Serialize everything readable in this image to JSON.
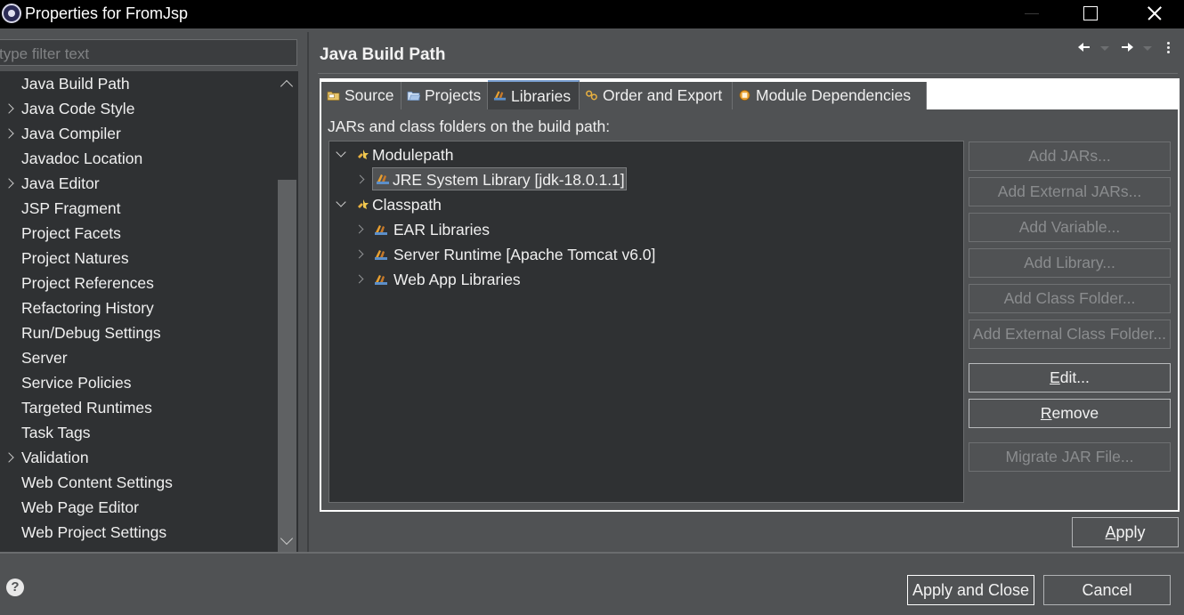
{
  "window": {
    "title": "Properties for FromJsp"
  },
  "filter": {
    "placeholder": "type filter text"
  },
  "nav_tree": {
    "items": [
      {
        "label": "Java Build Path",
        "expandable": false
      },
      {
        "label": "Java Code Style",
        "expandable": true
      },
      {
        "label": "Java Compiler",
        "expandable": true
      },
      {
        "label": "Javadoc Location",
        "expandable": false
      },
      {
        "label": "Java Editor",
        "expandable": true
      },
      {
        "label": "JSP Fragment",
        "expandable": false
      },
      {
        "label": "Project Facets",
        "expandable": false
      },
      {
        "label": "Project Natures",
        "expandable": false
      },
      {
        "label": "Project References",
        "expandable": false
      },
      {
        "label": "Refactoring History",
        "expandable": false
      },
      {
        "label": "Run/Debug Settings",
        "expandable": false
      },
      {
        "label": "Server",
        "expandable": false
      },
      {
        "label": "Service Policies",
        "expandable": false
      },
      {
        "label": "Targeted Runtimes",
        "expandable": false
      },
      {
        "label": "Task Tags",
        "expandable": false
      },
      {
        "label": "Validation",
        "expandable": true
      },
      {
        "label": "Web Content Settings",
        "expandable": false
      },
      {
        "label": "Web Page Editor",
        "expandable": false
      },
      {
        "label": "Web Project Settings",
        "expandable": false
      }
    ]
  },
  "page": {
    "title": "Java Build Path"
  },
  "tabs": [
    {
      "label": "Source",
      "icon": "source-folder-icon",
      "active": false
    },
    {
      "label": "Projects",
      "icon": "projects-folder-icon",
      "active": false
    },
    {
      "label": "Libraries",
      "icon": "libraries-icon",
      "active": true
    },
    {
      "label": "Order and Export",
      "icon": "order-export-icon",
      "active": false
    },
    {
      "label": "Module Dependencies",
      "icon": "module-icon",
      "active": false
    }
  ],
  "libraries": {
    "heading": "JARs and class folders on the build path:",
    "tree": {
      "modulepath": {
        "label": "Modulepath",
        "children": [
          "JRE System Library [jdk-18.0.1.1]"
        ]
      },
      "classpath": {
        "label": "Classpath",
        "children": [
          "EAR Libraries",
          "Server Runtime [Apache Tomcat v6.0]",
          "Web App Libraries"
        ]
      }
    },
    "selected": "JRE System Library [jdk-18.0.1.1]"
  },
  "buttons": {
    "add_jars": "Add JARs...",
    "add_external_jars": "Add External JARs...",
    "add_variable": "Add Variable...",
    "add_library": "Add Library...",
    "add_class_folder": "Add Class Folder...",
    "add_external_class_folder": "Add External Class Folder...",
    "edit_mnemonic": "E",
    "edit_rest": "dit...",
    "remove_mnemonic": "R",
    "remove_rest": "emove",
    "migrate_jar": "Migrate JAR File...",
    "apply_mnemonic": "A",
    "apply_rest": "pply",
    "apply_and_close": "Apply and Close",
    "cancel": "Cancel"
  },
  "colors": {
    "background": "#505254",
    "tree_background": "#2f3133",
    "title_bar": "#000000",
    "active_tab_accent": "#7a9fd0"
  }
}
